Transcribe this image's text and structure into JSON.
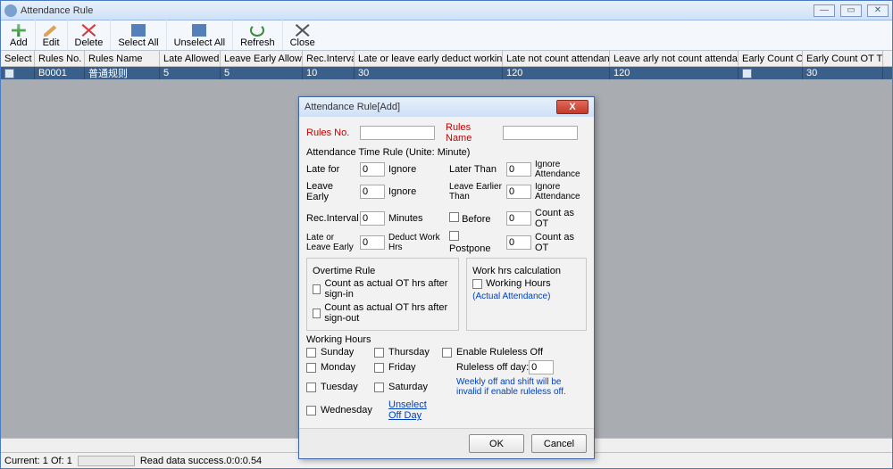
{
  "window": {
    "title": "Attendance Rule"
  },
  "toolbar": {
    "add": "Add",
    "edit": "Edit",
    "delete": "Delete",
    "select_all": "Select All",
    "unselect_all": "Unselect All",
    "refresh": "Refresh",
    "close": "Close"
  },
  "grid": {
    "headers": [
      "Select",
      "Rules No.",
      "Rules Name",
      "Late Allowed",
      "Leave Early Allowed",
      "Rec.Interval",
      "Late or leave early deduct working hrs",
      "Late not count attendance",
      "Leave arly not count attendance",
      "Early Count OT",
      "Early Count OT Time"
    ],
    "row": [
      "",
      "B0001",
      "普通规则",
      "5",
      "5",
      "10",
      "30",
      "120",
      "120",
      "",
      "30"
    ]
  },
  "status": {
    "current": "Current: 1  Of: 1",
    "msg": "Read data success.0:0:0.54"
  },
  "dialog": {
    "title": "Attendance Rule[Add]",
    "rules_no_lbl": "Rules No.",
    "rules_name_lbl": "Rules Name",
    "section_time": "Attendance Time Rule (Unite: Minute)",
    "late_for": "Late for",
    "ignore": "Ignore",
    "later_than": "Later Than",
    "ignore_attendance": "Ignore Attendance",
    "leave_early": "Leave Early",
    "leave_earlier_than": "Leave Earlier Than",
    "rec_interval": "Rec.Interval",
    "minutes": "Minutes",
    "before": "Before",
    "count_as_ot": "Count as OT",
    "late_or_leave": "Late or Leave Early",
    "deduct_work_hrs": "Deduct Work Hrs",
    "postpone": "Postpone",
    "v0": "0",
    "overtime_rule": "Overtime Rule",
    "count_signin": "Count as actual OT hrs after sign-in",
    "count_signout": "Count as actual OT hrs after sign-out",
    "work_hrs_calc": "Work hrs calculation",
    "working_hours_cb": "Working Hours",
    "actual_attendance": "(Actual Attendance)",
    "working_hours": "Working Hours",
    "days": {
      "sun": "Sunday",
      "mon": "Monday",
      "tue": "Tuesday",
      "wed": "Wednesday",
      "thu": "Thursday",
      "fri": "Friday",
      "sat": "Saturday"
    },
    "unselect_off_day": "Unselect Off Day",
    "enable_ruleless": "Enable Ruleless Off",
    "ruleless_off_day": "Ruleless off day:",
    "ruleless_val": "0",
    "note": "Weekly off and shift will be invalid if enable ruleless off.",
    "ok": "OK",
    "cancel": "Cancel"
  }
}
